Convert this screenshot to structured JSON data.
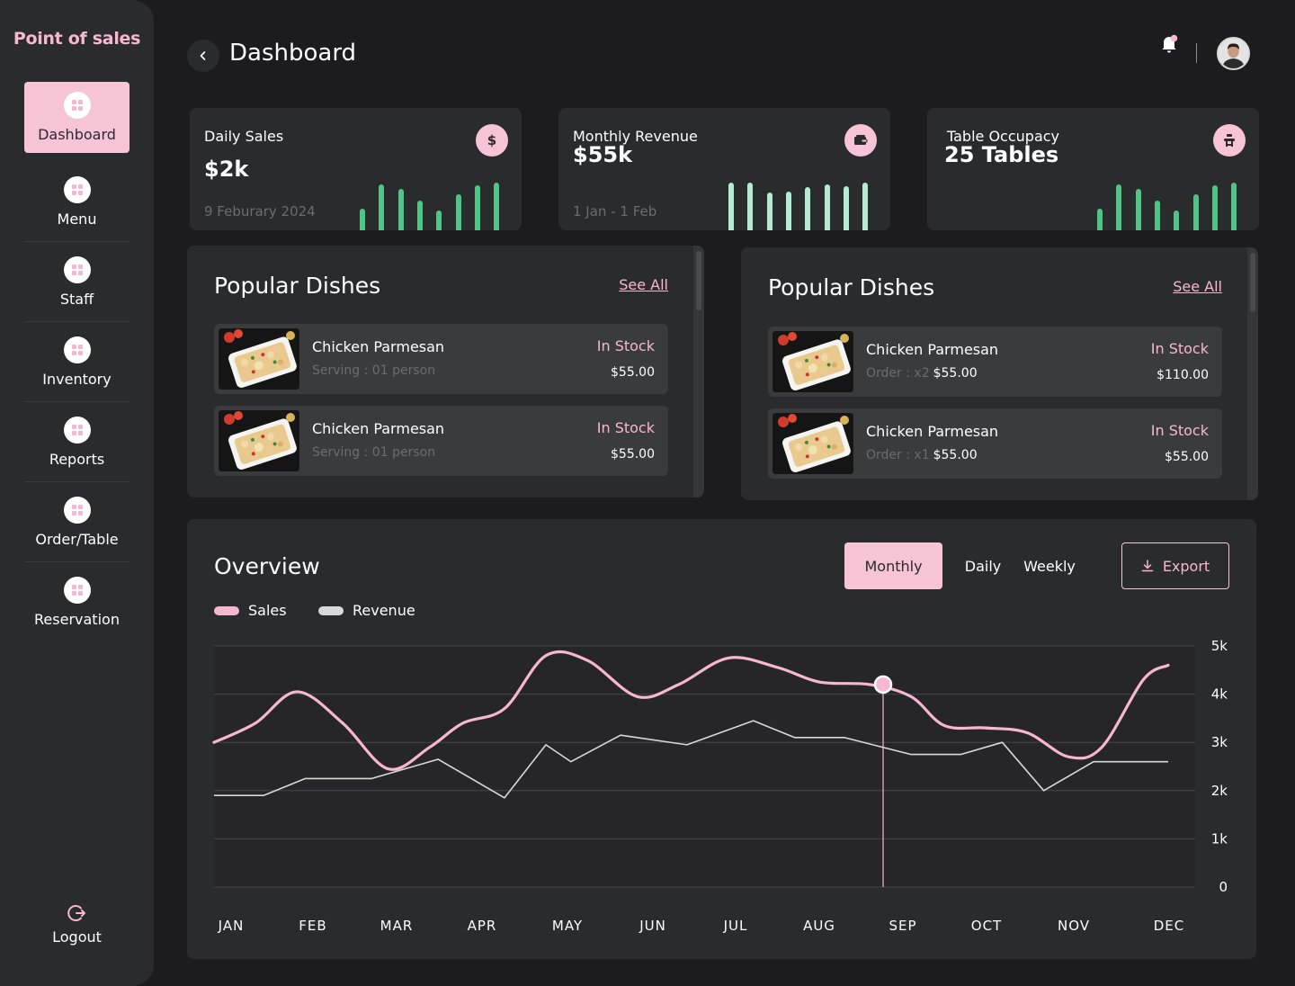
{
  "sidebar": {
    "brand": "Point of sales",
    "items": [
      {
        "label": "Dashboard",
        "active": true
      },
      {
        "label": "Menu"
      },
      {
        "label": "Staff"
      },
      {
        "label": "Inventory"
      },
      {
        "label": "Reports"
      },
      {
        "label": "Order/Table"
      },
      {
        "label": "Reservation"
      }
    ],
    "logout": "Logout"
  },
  "header": {
    "title": "Dashboard"
  },
  "kpis": [
    {
      "title": "Daily Sales",
      "value": "$2k",
      "date": "9 Feburary 2024",
      "icon": "dollar-icon",
      "bar_color": "#4fc486"
    },
    {
      "title": "Monthly Revenue",
      "value": "$55k",
      "date": "1 Jan - 1 Feb",
      "icon": "wallet-icon",
      "bar_color": "#b5ead3"
    },
    {
      "title": "Table Occupacy",
      "value": "25 Tables",
      "date": "",
      "icon": "table-icon",
      "bar_color": "#4fc486"
    }
  ],
  "dishes_left": {
    "title": "Popular Dishes",
    "see_all": "See All",
    "items": [
      {
        "name": "Chicken Parmesan",
        "sub": "Serving : 01 person",
        "sub_value": "",
        "stock": "In Stock",
        "price": "$55.00"
      },
      {
        "name": "Chicken Parmesan",
        "sub": "Serving : 01 person",
        "sub_value": "",
        "stock": "In Stock",
        "price": "$55.00"
      }
    ]
  },
  "dishes_right": {
    "title": "Popular Dishes",
    "see_all": "See All",
    "items": [
      {
        "name": "Chicken Parmesan",
        "sub": "Order : x2",
        "sub_value": "$55.00",
        "stock": "In Stock",
        "price": "$110.00"
      },
      {
        "name": "Chicken Parmesan",
        "sub": "Order : x1",
        "sub_value": "$55.00",
        "stock": "In Stock",
        "price": "$55.00"
      }
    ]
  },
  "overview": {
    "title": "Overview",
    "tabs": [
      "Monthly",
      "Daily",
      "Weekly"
    ],
    "active_tab": "Monthly",
    "export_label": "Export"
  },
  "colors": {
    "accent": "#f7c4d6",
    "sales": "#f7b7cf",
    "revenue": "#d9d9d9",
    "panel": "#2a2b2d",
    "bg": "#1c1c1e"
  },
  "chart_data": {
    "type": "line",
    "categories": [
      "JAN",
      "FEB",
      "MAR",
      "APR",
      "MAY",
      "JUN",
      "JUL",
      "AUG",
      "SEP",
      "OCT",
      "NOV",
      "DEC"
    ],
    "y_ticks": [
      "0",
      "1k",
      "2k",
      "3k",
      "4k",
      "5k"
    ],
    "ylim": [
      0,
      5000
    ],
    "grid": true,
    "legend": "top-left",
    "highlight": {
      "category": "SEP",
      "series": "Sales",
      "value": 4200
    },
    "series": [
      {
        "name": "Sales",
        "color": "#f7b7cf",
        "points": [
          [
            0,
            3000
          ],
          [
            0.5,
            3400
          ],
          [
            1.0,
            4050
          ],
          [
            1.55,
            3400
          ],
          [
            2.1,
            2450
          ],
          [
            2.6,
            2900
          ],
          [
            3.0,
            3400
          ],
          [
            3.5,
            3700
          ],
          [
            4.0,
            4800
          ],
          [
            4.5,
            4700
          ],
          [
            5.1,
            3950
          ],
          [
            5.6,
            4200
          ],
          [
            6.2,
            4750
          ],
          [
            6.8,
            4550
          ],
          [
            7.3,
            4250
          ],
          [
            7.9,
            4200
          ],
          [
            8.4,
            3950
          ],
          [
            8.8,
            3350
          ],
          [
            9.3,
            3300
          ],
          [
            9.8,
            3200
          ],
          [
            10.3,
            2700
          ],
          [
            10.7,
            2900
          ],
          [
            11.2,
            4300
          ],
          [
            11.5,
            4600
          ]
        ]
      },
      {
        "name": "Revenue",
        "color": "#d9d9d9",
        "points": [
          [
            0,
            1900
          ],
          [
            0.6,
            1900
          ],
          [
            1.1,
            2250
          ],
          [
            1.9,
            2250
          ],
          [
            2.7,
            2650
          ],
          [
            3.5,
            1850
          ],
          [
            4.0,
            2950
          ],
          [
            4.3,
            2600
          ],
          [
            4.9,
            3150
          ],
          [
            5.7,
            2950
          ],
          [
            6.5,
            3450
          ],
          [
            7.0,
            3100
          ],
          [
            7.6,
            3100
          ],
          [
            8.4,
            2750
          ],
          [
            9.0,
            2750
          ],
          [
            9.5,
            3000
          ],
          [
            10.0,
            2000
          ],
          [
            10.6,
            2600
          ],
          [
            11.5,
            2600
          ]
        ]
      }
    ]
  }
}
